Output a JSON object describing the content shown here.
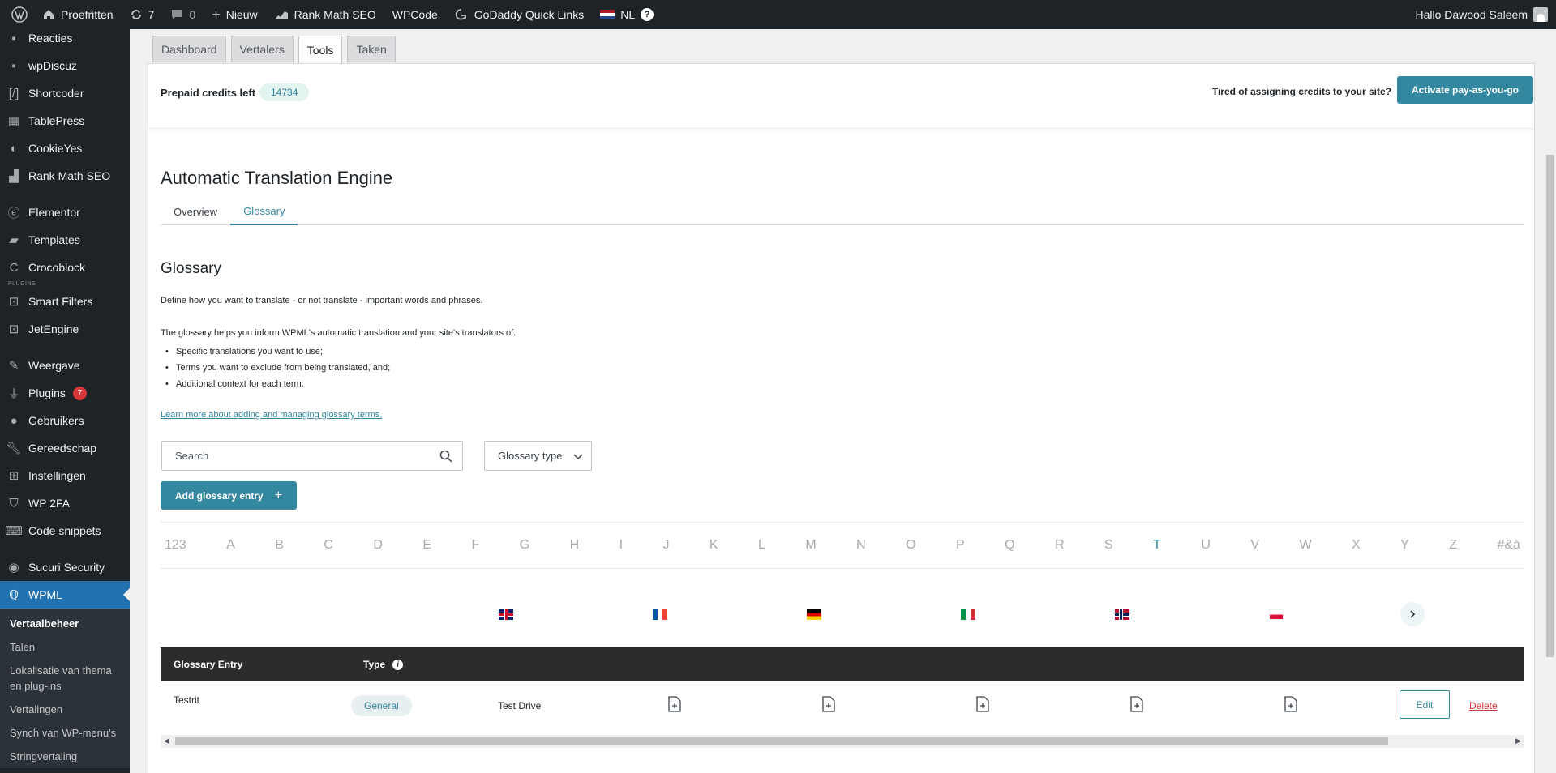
{
  "adminbar": {
    "site_name": "Proefritten",
    "updates_count": "7",
    "comments_count": "0",
    "new_label": "Nieuw",
    "rankmath_label": "Rank Math SEO",
    "wpcode_label": "WPCode",
    "godaddy_label": "GoDaddy Quick Links",
    "lang_label": "NL",
    "greeting": "Hallo Dawood Saleem"
  },
  "sidebar": {
    "plugins_separator": "PLUGINS",
    "items": [
      {
        "label": "Reacties",
        "icon": "comment-icon"
      },
      {
        "label": "wpDiscuz",
        "icon": "comment-icon"
      },
      {
        "label": "Shortcoder",
        "icon": "shortcode-icon"
      },
      {
        "label": "TablePress",
        "icon": "table-icon"
      },
      {
        "label": "CookieYes",
        "icon": "cookie-icon"
      },
      {
        "label": "Rank Math SEO",
        "icon": "chart-icon"
      },
      {
        "label": "Elementor",
        "icon": "elementor-icon"
      },
      {
        "label": "Templates",
        "icon": "folder-icon"
      },
      {
        "label": "Crocoblock",
        "icon": "crocoblock-icon"
      },
      {
        "label": "Smart Filters",
        "icon": "jet-icon"
      },
      {
        "label": "JetEngine",
        "icon": "jet-icon"
      },
      {
        "label": "Weergave",
        "icon": "brush-icon"
      },
      {
        "label": "Plugins",
        "icon": "plug-icon",
        "badge": "7"
      },
      {
        "label": "Gebruikers",
        "icon": "user-icon"
      },
      {
        "label": "Gereedschap",
        "icon": "wrench-icon"
      },
      {
        "label": "Instellingen",
        "icon": "settings-icon"
      },
      {
        "label": "WP 2FA",
        "icon": "shield-icon"
      },
      {
        "label": "Code snippets",
        "icon": "code-icon"
      },
      {
        "label": "Sucuri Security",
        "icon": "sucuri-icon"
      },
      {
        "label": "WPML",
        "icon": "wpml-icon"
      }
    ],
    "submenu": [
      "Vertaalbeheer",
      "Talen",
      "Lokalisatie van thema en plug-ins",
      "Vertalingen",
      "Synch van WP-menu's",
      "Stringvertaling"
    ]
  },
  "tabs": [
    "Dashboard",
    "Vertalers",
    "Tools",
    "Taken"
  ],
  "credits": {
    "label": "Prepaid credits left",
    "value": "14734",
    "tired_text": "Tired of assigning credits to your site?",
    "activate_label": "Activate pay-as-you-go"
  },
  "ate": {
    "title": "Automatic Translation Engine",
    "subtabs": [
      "Overview",
      "Glossary"
    ]
  },
  "glossary": {
    "title": "Glossary",
    "description": "Define how you want to translate - or not translate - important words and phrases.",
    "intro": "The glossary helps you inform WPML's automatic translation and your site's translators of:",
    "bullets": [
      "Specific translations you want to use;",
      "Terms you want to exclude from being translated, and;",
      "Additional context for each term."
    ],
    "learn_more": "Learn more about adding and managing glossary terms.",
    "search_placeholder": "Search",
    "type_select": "Glossary type",
    "add_label": "Add glossary entry",
    "alphabet": [
      "123",
      "A",
      "B",
      "C",
      "D",
      "E",
      "F",
      "G",
      "H",
      "I",
      "J",
      "K",
      "L",
      "M",
      "N",
      "O",
      "P",
      "Q",
      "R",
      "S",
      "T",
      "U",
      "V",
      "W",
      "X",
      "Y",
      "Z",
      "#&à"
    ],
    "active_letter": "T",
    "languages": [
      "flag-gb-icon",
      "flag-fr-icon",
      "flag-de-icon",
      "flag-it-icon",
      "flag-no-icon",
      "flag-pl-icon"
    ],
    "table": {
      "col_entry": "Glossary Entry",
      "col_type": "Type",
      "rows": [
        {
          "entry": "Testrit",
          "type": "General",
          "translation": "Test Drive",
          "edit": "Edit",
          "delete": "Delete"
        }
      ]
    }
  },
  "colors": {
    "accent": "#33879e",
    "adminbar": "#1d2327",
    "wp_blue": "#2271b1",
    "danger": "#d63638"
  }
}
